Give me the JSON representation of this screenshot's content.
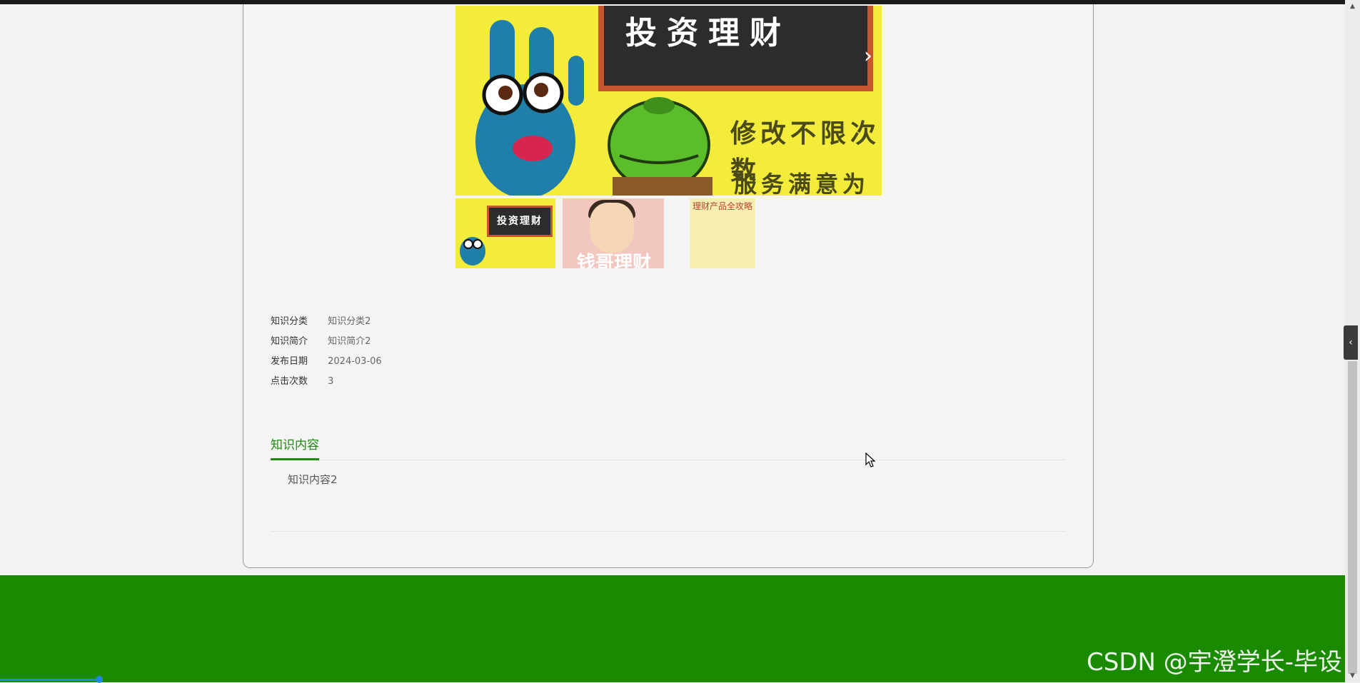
{
  "gallery": {
    "main_board_text": "投资理财",
    "main_side_text": "修改不限次数",
    "main_side_text_2": "服务满意为止",
    "next_icon": "chevron-right-icon",
    "thumbs": [
      {
        "text": "投资理财"
      },
      {
        "text": "钱哥理财"
      },
      {
        "text": "理财产品全攻略"
      }
    ]
  },
  "info": {
    "rows": [
      {
        "label": "知识分类",
        "value": "知识分类2"
      },
      {
        "label": "知识简介",
        "value": "知识简介2"
      },
      {
        "label": "发布日期",
        "value": "2024-03-06"
      },
      {
        "label": "点击次数",
        "value": "3"
      }
    ]
  },
  "tabs": {
    "active_label": "知识内容",
    "content": "知识内容2"
  },
  "footer": {
    "watermark": "CSDN @宇澄学长-毕设"
  },
  "colors": {
    "accent": "#1d8a10",
    "footer": "#1a8b00",
    "progress": "#1e88e5"
  }
}
